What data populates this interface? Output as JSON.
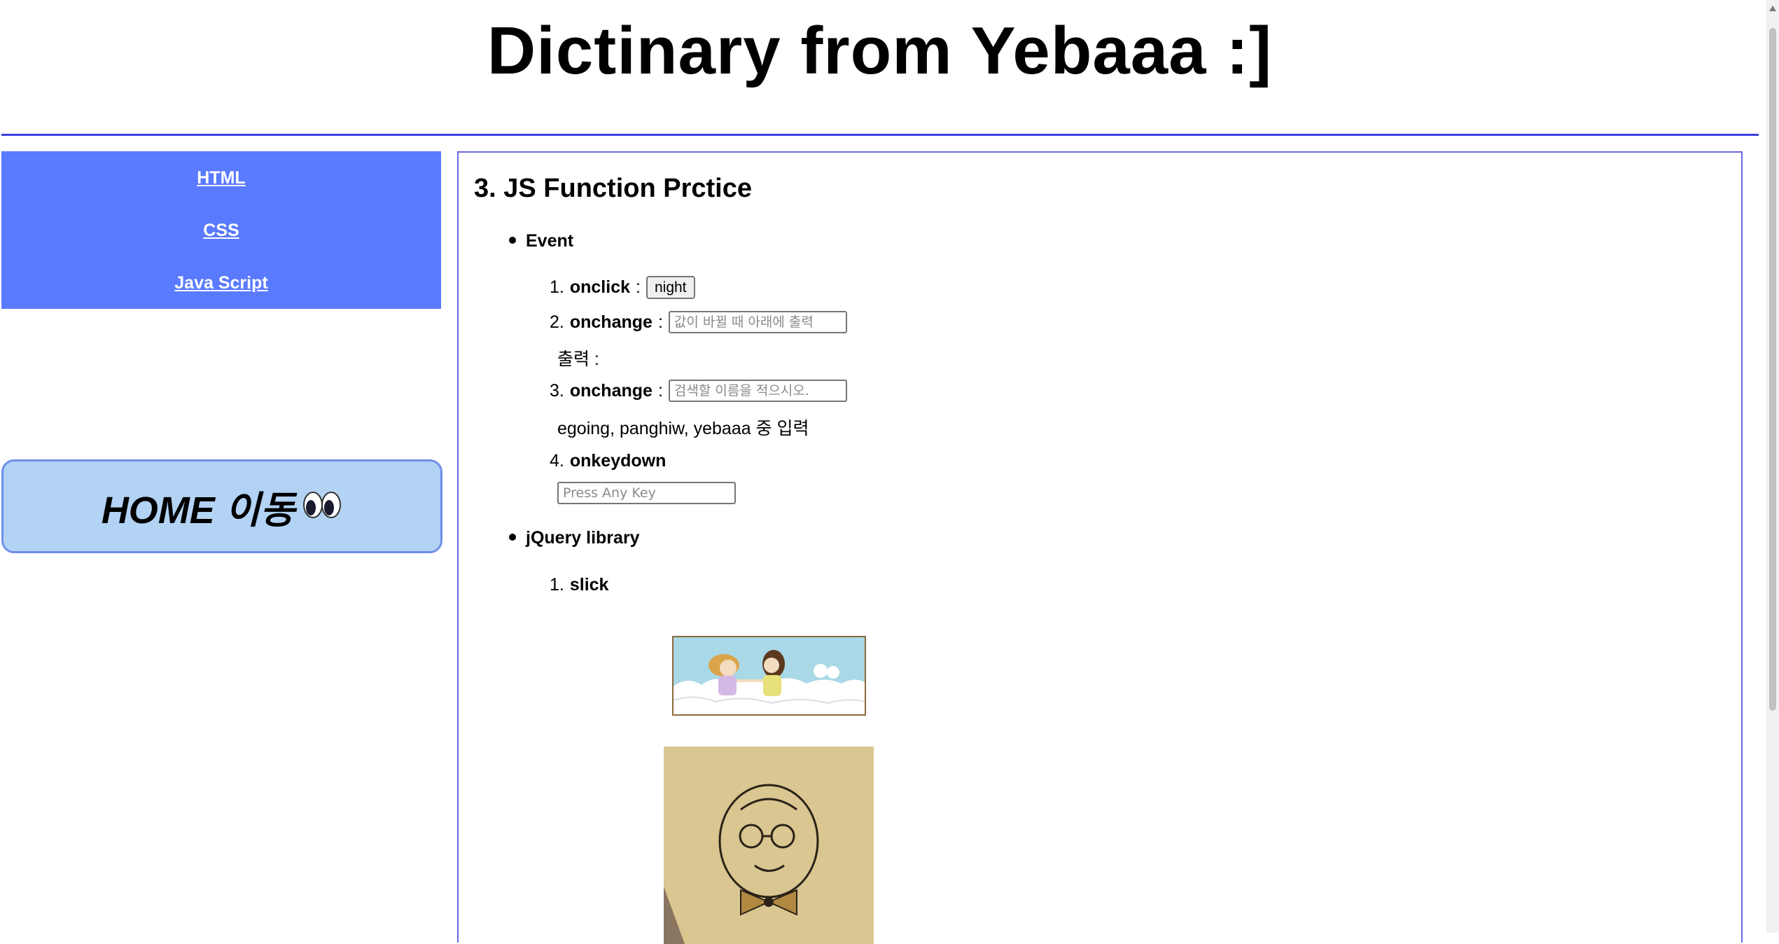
{
  "header": {
    "title": "Dictinary from Yebaaa :]"
  },
  "sidebar": {
    "links": [
      {
        "label": "HTML"
      },
      {
        "label": "CSS"
      },
      {
        "label": "Java Script"
      }
    ],
    "home_button_label": "HOME 이동",
    "home_icon": "eyes-icon"
  },
  "content": {
    "section_title": "3. JS Function Prctice",
    "event": {
      "heading": "Event",
      "items": [
        {
          "num": "1.",
          "key": "onclick",
          "colon": ":",
          "button_label": "night"
        },
        {
          "num": "2.",
          "key": "onchange",
          "colon": ":",
          "placeholder": "값이 바뀔 때 아래에 출력"
        },
        {
          "num": "3.",
          "key": "onchange",
          "colon": ":",
          "placeholder": "검색할 이름을 적으시오."
        },
        {
          "num": "4.",
          "key": "onkeydown"
        }
      ],
      "output_label": "출력 :",
      "names_hint": "egoing, panghiw, yebaaa 중 입력",
      "keydown_placeholder": "Press Any Key"
    },
    "jquery": {
      "heading": "jQuery library",
      "items": [
        {
          "num": "1.",
          "key": "slick"
        }
      ]
    }
  },
  "colors": {
    "sidebar_bg": "#5a7aff",
    "home_bg": "#b3d3f5",
    "accent_border": "#3f3fe0"
  }
}
